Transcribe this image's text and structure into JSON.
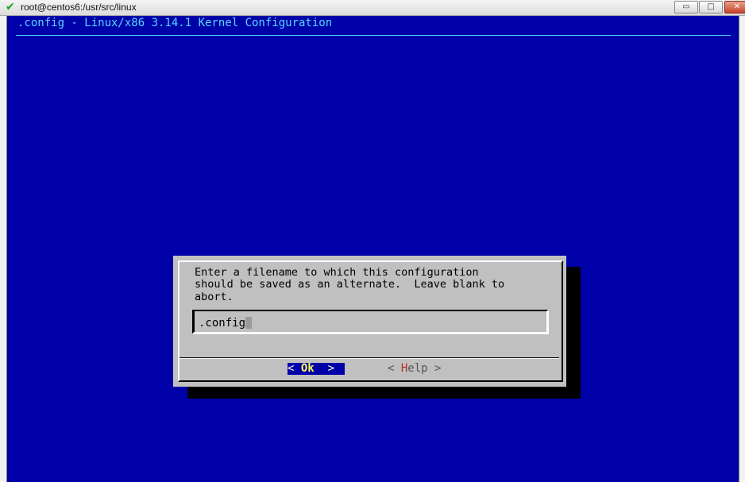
{
  "window": {
    "title": "root@centos6:/usr/src/linux",
    "check_glyph": "✔",
    "minimize_glyph": "▭",
    "maximize_glyph": "□",
    "close_glyph": "✕"
  },
  "header": {
    "title": ".config - Linux/x86 3.14.1 Kernel Configuration"
  },
  "dialog": {
    "prompt": "Enter a filename to which this configuration\nshould be saved as an alternate.  Leave blank to\nabort.",
    "input_value": ".config",
    "ok_left": "< ",
    "ok_hotkey": "O",
    "ok_rest": "k",
    "ok_right": "  >",
    "help_left": "< ",
    "help_hotkey": "H",
    "help_rest": "elp",
    "help_right": " >"
  },
  "colors": {
    "background": "#0000a8",
    "header_text": "#54d8ff",
    "dialog_bg": "#c0c0c0",
    "hotkey_selected": "#ffff54",
    "hotkey_unselected": "#b03020"
  },
  "icons": {
    "title_status": "check-icon",
    "minimize": "minimize-icon",
    "maximize": "maximize-icon",
    "close": "close-icon"
  }
}
